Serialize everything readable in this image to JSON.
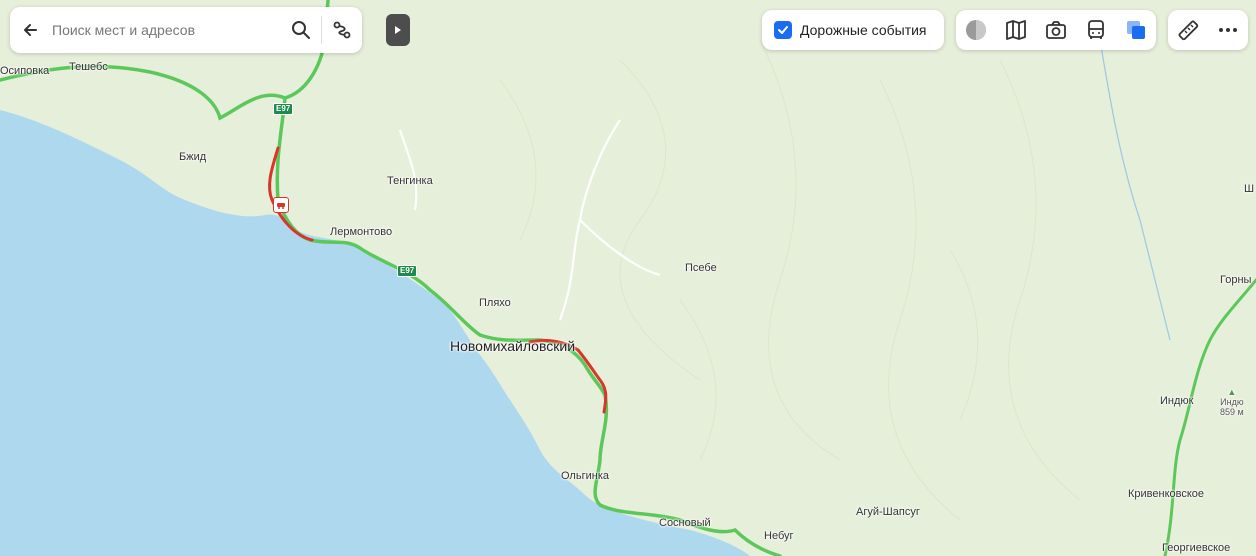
{
  "search": {
    "placeholder": "Поиск мест и адресов"
  },
  "traffic": {
    "label": "Дорожные события",
    "checked": true
  },
  "road_shield": "E97",
  "places": {
    "osipovka": "Осиповка",
    "teshebs": "Тешебс",
    "bzhid": "Бжид",
    "tenginka": "Тенгинка",
    "lermontovo": "Лермонтово",
    "psebe": "Псебе",
    "plyakho": "Пляхо",
    "novomikhaylovskiy": "Новомихайловский",
    "olginka": "Ольгинка",
    "sosnovyy": "Сосновый",
    "nebug": "Небуг",
    "agui_shapsug": "Агуй-Шапсуг",
    "indyuk": "Индюк",
    "indyuk_peak": "Индю",
    "indyuk_peak_height": "859 м",
    "krivenkovskoe": "Кривенковское",
    "gorny": "Горны",
    "sh": "Ш",
    "georgievskoe": "Георгиевское"
  },
  "colors": {
    "sea": "#aed8ee",
    "land": "#e6efd9",
    "road_green": "#5cc85c",
    "road_red": "#d9352a",
    "accent": "#1a6cf0"
  },
  "icons": {
    "back": "arrow-left-icon",
    "search": "search-icon",
    "route": "route-icon",
    "collapse": "play-right-icon",
    "checkbox": "checkmark-icon",
    "theme": "circle-icon",
    "panorama": "map-book-icon",
    "camera": "camera-icon",
    "transit": "bus-icon",
    "layers": "layers-icon",
    "ruler": "ruler-icon",
    "more": "more-dots-icon"
  }
}
